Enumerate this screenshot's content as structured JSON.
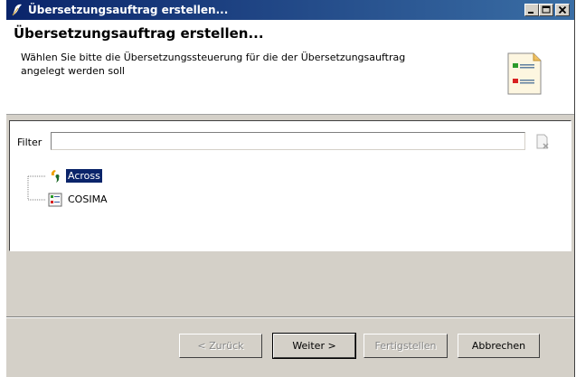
{
  "window": {
    "title": "Übersetzungsauftrag erstellen...",
    "title_bar_color": "#0a246a",
    "buttons": [
      "minimize-icon",
      "maximize-icon",
      "close-icon"
    ]
  },
  "header": {
    "title": "Übersetzungsauftrag erstellen...",
    "description": "Wählen Sie bitte die Übersetzungssteuerung für die der Übersetzungsauftrag angelegt werden soll",
    "image_icon": "wizard-banner-icon"
  },
  "filter": {
    "label": "Filter",
    "value": "",
    "clear_icon": "clear-filter-icon"
  },
  "tree": {
    "items": [
      {
        "label": "Across",
        "icon": "across-logo-icon",
        "selected": true
      },
      {
        "label": "COSIMA",
        "icon": "cosima-icon",
        "selected": false
      }
    ]
  },
  "buttons": {
    "back": "< Zurück",
    "next": "Weiter >",
    "finish": "Fertigstellen",
    "cancel": "Abbrechen"
  },
  "colors": {
    "selection": "#0a246a",
    "dialog_bg": "#d4d0c8"
  }
}
